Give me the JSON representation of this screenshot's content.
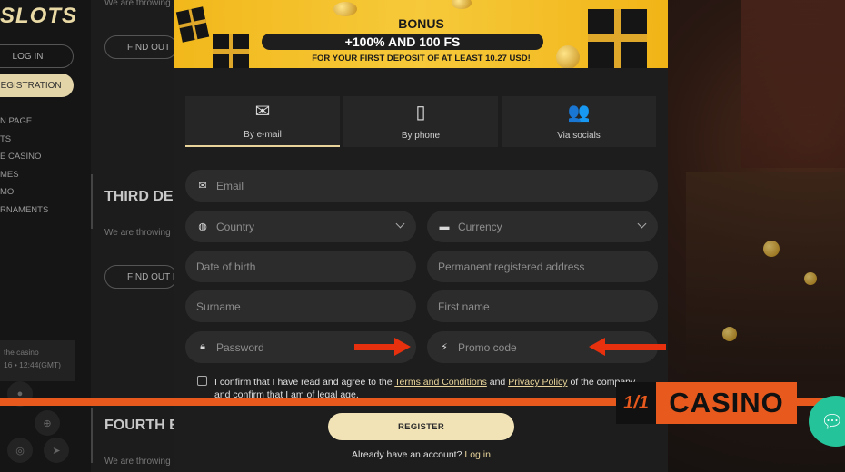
{
  "background": {
    "logo": "SLOTS",
    "login_label": "LOG IN",
    "registration_label": "REGISTRATION",
    "menu": [
      "N PAGE",
      "TS",
      "E CASINO",
      "MES",
      "MO",
      "RNAMENTS"
    ],
    "info_line1": "the casino",
    "info_line2": "16 • 12:44(GMT)",
    "snippets": {
      "top_text": "We are throwing",
      "find_out_1": "FIND OUT",
      "third_heading": "THIRD DE",
      "third_text": "We are throwing",
      "find_out_2": "FIND OUT M",
      "fourth_heading": "FOURTH E",
      "fourth_text": "We are throwing"
    }
  },
  "banner": {
    "title": "BONUS",
    "offer": "+100% AND 100 FS",
    "subtitle": "FOR YOUR FIRST DEPOSIT OF AT LEAST 10.27 USD!"
  },
  "tabs": [
    {
      "label": "By e-mail",
      "icon": "envelope-icon",
      "active": true
    },
    {
      "label": "By phone",
      "icon": "phone-icon",
      "active": false
    },
    {
      "label": "Via socials",
      "icon": "users-icon",
      "active": false
    }
  ],
  "form": {
    "email_placeholder": "Email",
    "country_placeholder": "Country",
    "currency_placeholder": "Currency",
    "dob_placeholder": "Date of birth",
    "address_placeholder": "Permanent registered address",
    "surname_placeholder": "Surname",
    "firstname_placeholder": "First name",
    "password_placeholder": "Password",
    "promo_placeholder": "Promo code"
  },
  "consent": {
    "part1": "I confirm that I have read and agree to the ",
    "terms": "Terms and Conditions",
    "and": " and ",
    "privacy": "Privacy Policy",
    "part2": " of the company and confirm that I am of legal age."
  },
  "register_label": "REGISTER",
  "login_prompt": "Already have an account?",
  "login_link": "Log in",
  "overlay": {
    "brand_mark": "1/1",
    "brand_text": "CASINO",
    "chat_icon": "chat-bubble-icon"
  },
  "colors": {
    "accent": "#e8d49a",
    "banner": "#f2b81b",
    "overlay_orange": "#e8591d",
    "arrow_red": "#e6300e",
    "chat_green": "#25c39a"
  }
}
